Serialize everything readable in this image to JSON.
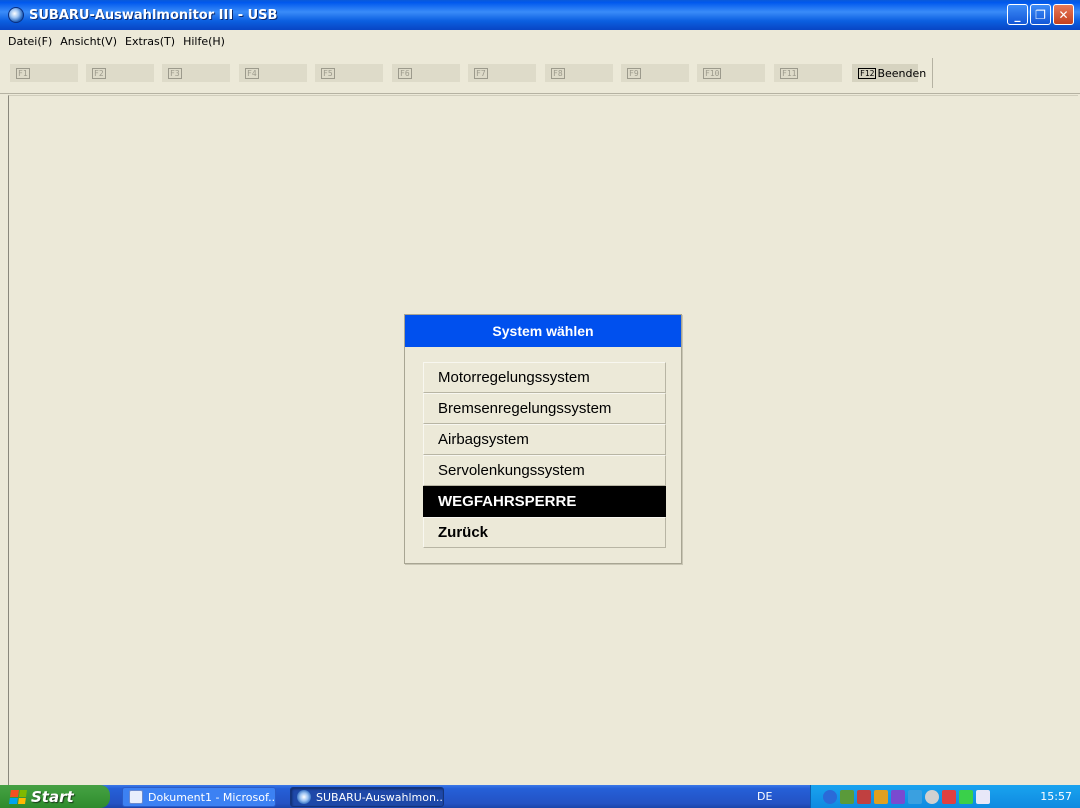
{
  "window": {
    "title": "SUBARU-Auswahlmonitor III - USB",
    "buttons": {
      "minimize": "_",
      "maximize": "❐",
      "close": "✕"
    }
  },
  "menu": [
    "Datei(F)",
    "Ansicht(V)",
    "Extras(T)",
    "Hilfe(H)"
  ],
  "fkeys": [
    {
      "key": "F1",
      "label": ""
    },
    {
      "key": "F2",
      "label": ""
    },
    {
      "key": "F3",
      "label": ""
    },
    {
      "key": "F4",
      "label": ""
    },
    {
      "key": "F5",
      "label": ""
    },
    {
      "key": "F6",
      "label": ""
    },
    {
      "key": "F7",
      "label": ""
    },
    {
      "key": "F8",
      "label": ""
    },
    {
      "key": "F9",
      "label": ""
    },
    {
      "key": "F10",
      "label": ""
    },
    {
      "key": "F11",
      "label": ""
    },
    {
      "key": "F12",
      "label": "Beenden"
    }
  ],
  "dialog": {
    "title": "System wählen",
    "options": [
      "Motorregelungssystem",
      "Bremsenregelungssystem",
      "Airbagsystem",
      "Servolenkungssystem",
      "WEGFAHRSPERRE",
      "Zurück"
    ],
    "selected_option": "WEGFAHRSPERRE"
  },
  "taskbar": {
    "start_label": "Start",
    "tasks": [
      "Dokument1 - Microsof...",
      "SUBARU-Auswahlmon..."
    ],
    "language": "DE",
    "clock": "15:57"
  },
  "colors": {
    "titlebar": "#0058ee",
    "dialog_header": "#0050ee",
    "selected_bg": "#000000",
    "background": "#ece9d8"
  }
}
